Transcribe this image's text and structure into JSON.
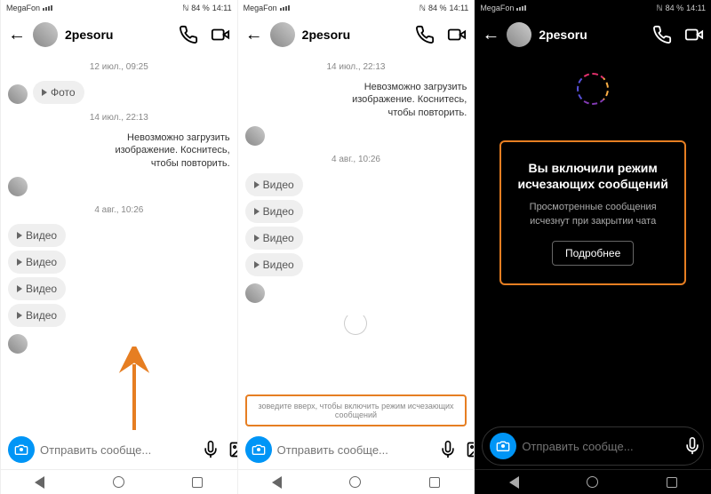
{
  "status": {
    "carrier": "MegaFon",
    "nfc": "ℕ",
    "batt": "84 %",
    "time": "14:11"
  },
  "user": {
    "name": "2pesoru"
  },
  "p1": {
    "ts1": "12 июл., 09:25",
    "photo": "Фото",
    "ts2": "14 июл., 22:13",
    "err": "Невозможно загрузить изображение. Коснитесь, чтобы повторить.",
    "ts3": "4 авг., 10:26",
    "vid": "Видео"
  },
  "p2": {
    "ts1": "14 июл., 22:13",
    "err": "Невозможно загрузить изображение. Коснитесь, чтобы повторить.",
    "ts2": "4 авг., 10:26",
    "vid": "Видео",
    "hint": "зоведите вверх, чтобы включить режим исчезающих сообщений"
  },
  "p3": {
    "title": "Вы включили режим исчезающих сообщений",
    "sub": "Просмотренные сообщения исчезнут при закрытии чата",
    "btn": "Подробнее"
  },
  "input": {
    "ph": "Отправить сообще..."
  }
}
